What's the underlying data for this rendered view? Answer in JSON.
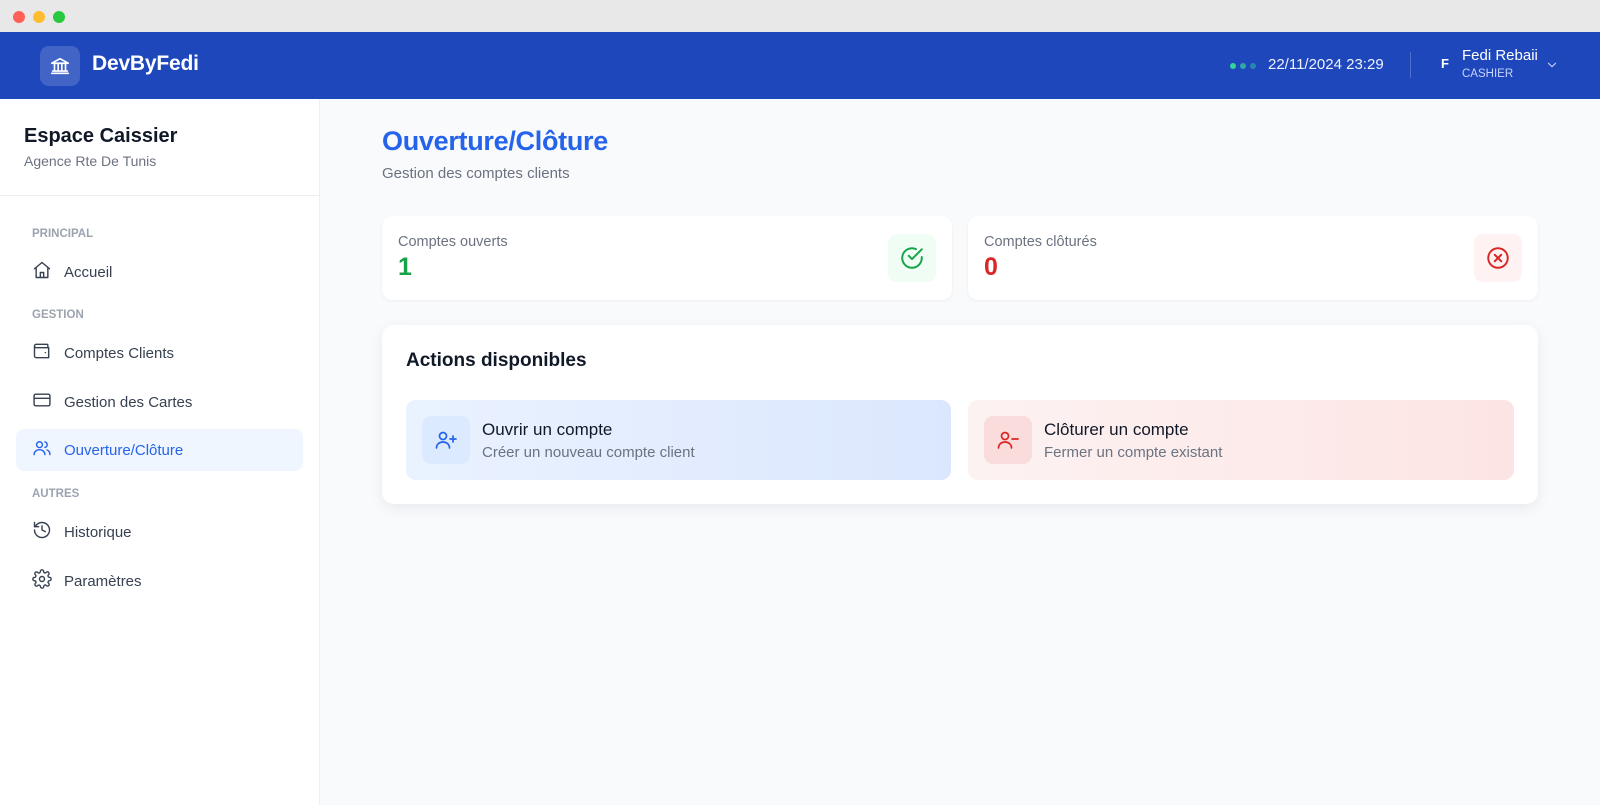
{
  "window": {
    "controls": [
      "close",
      "minimize",
      "maximize"
    ]
  },
  "header": {
    "brand": "DevByFedi",
    "logo_icon": "bank-icon",
    "datetime": "22/11/2024 23:29",
    "user": {
      "initial": "F",
      "name": "Fedi Rebaii",
      "role": "CASHIER"
    }
  },
  "sidebar": {
    "title": "Espace Caissier",
    "subtitle": "Agence Rte De Tunis",
    "sections": [
      {
        "label": "PRINCIPAL",
        "items": [
          {
            "label": "Accueil",
            "icon": "home-icon"
          }
        ]
      },
      {
        "label": "GESTION",
        "items": [
          {
            "label": "Comptes Clients",
            "icon": "wallet-icon"
          },
          {
            "label": "Gestion des Cartes",
            "icon": "credit-card-icon"
          },
          {
            "label": "Ouverture/Clôture",
            "icon": "users-icon",
            "active": true
          }
        ]
      },
      {
        "label": "AUTRES",
        "items": [
          {
            "label": "Historique",
            "icon": "history-icon"
          },
          {
            "label": "Paramètres",
            "icon": "settings-icon"
          }
        ]
      }
    ]
  },
  "main": {
    "title": "Ouverture/Clôture",
    "subtitle": "Gestion des comptes clients",
    "stats": [
      {
        "label": "Comptes ouverts",
        "value": "1",
        "color": "#16a34a",
        "icon": "check-circle-icon"
      },
      {
        "label": "Comptes clôturés",
        "value": "0",
        "color": "#dc2626",
        "icon": "x-circle-icon"
      }
    ],
    "actions": {
      "title": "Actions disponibles",
      "items": [
        {
          "title": "Ouvrir un compte",
          "description": "Créer un nouveau compte client",
          "icon": "user-plus-icon"
        },
        {
          "title": "Clôturer un compte",
          "description": "Fermer un compte existant",
          "icon": "user-minus-icon"
        }
      ]
    }
  },
  "colors": {
    "header": "#1e47bb",
    "accent": "#2563eb",
    "success": "#16a34a",
    "danger": "#dc2626"
  }
}
